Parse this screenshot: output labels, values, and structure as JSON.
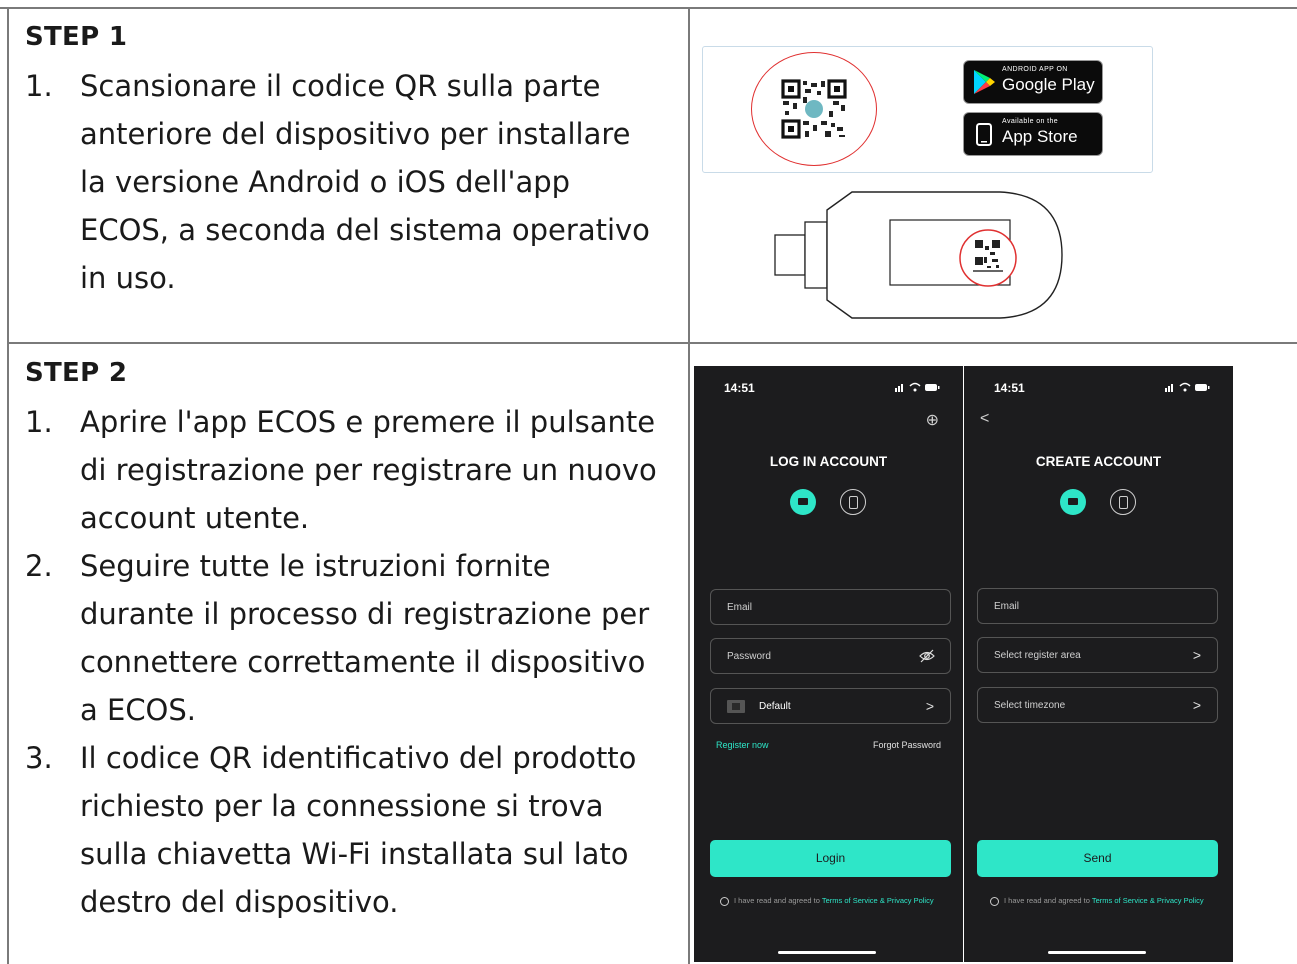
{
  "step1": {
    "title": "STEP 1",
    "items": [
      {
        "num": "1.",
        "text": "Scansionare il codice QR sulla parte anteriore del dispositivo per installare la versione Android o iOS dell'app ECOS, a seconda del sistema operativo in uso."
      }
    ],
    "google_play": {
      "small": "ANDROID APP ON",
      "label": "Google Play"
    },
    "app_store": {
      "small": "Available on the",
      "label": "App Store"
    }
  },
  "step2": {
    "title": "STEP 2",
    "items": [
      {
        "num": "1.",
        "text": "Aprire l'app ECOS e premere il pulsante di registrazione per registrare un nuovo account utente."
      },
      {
        "num": "2.",
        "text": "Seguire tutte le istruzioni fornite durante il processo di registrazione per connettere correttamente il dispositivo a ECOS."
      },
      {
        "num": "3.",
        "text": "Il codice QR identificativo del prodotto richiesto per la connessione si trova sulla chiavetta Wi-Fi installata sul lato destro del dispositivo."
      }
    ]
  },
  "login_screen": {
    "time": "14:51",
    "heading": "LOG IN ACCOUNT",
    "email_label": "Email",
    "password_label": "Password",
    "region_label": "Default",
    "register_link": "Register now",
    "forgot_link": "Forgot Password",
    "button_label": "Login",
    "agree_prefix": "I have read and agreed to",
    "terms_link": "Terms of Service",
    "amp": "&",
    "privacy_link": "Privacy Policy"
  },
  "create_screen": {
    "time": "14:51",
    "heading": "CREATE ACCOUNT",
    "email_label": "Email",
    "area_label": "Select register area",
    "timezone_label": "Select timezone",
    "button_label": "Send",
    "agree_prefix": "I have read and agreed to",
    "terms_link": "Terms of Service",
    "amp": "&",
    "privacy_link": "Privacy Policy"
  },
  "colors": {
    "accent": "#2ee6c8",
    "phone_bg": "#1c1c1e",
    "qr_circle": "#e03030"
  },
  "icons": [
    "globe-icon",
    "back-arrow-icon",
    "email-icon",
    "phone-icon",
    "eye-off-icon",
    "chevron-right-icon",
    "google-play-icon",
    "apple-icon",
    "qr-code-icon"
  ]
}
